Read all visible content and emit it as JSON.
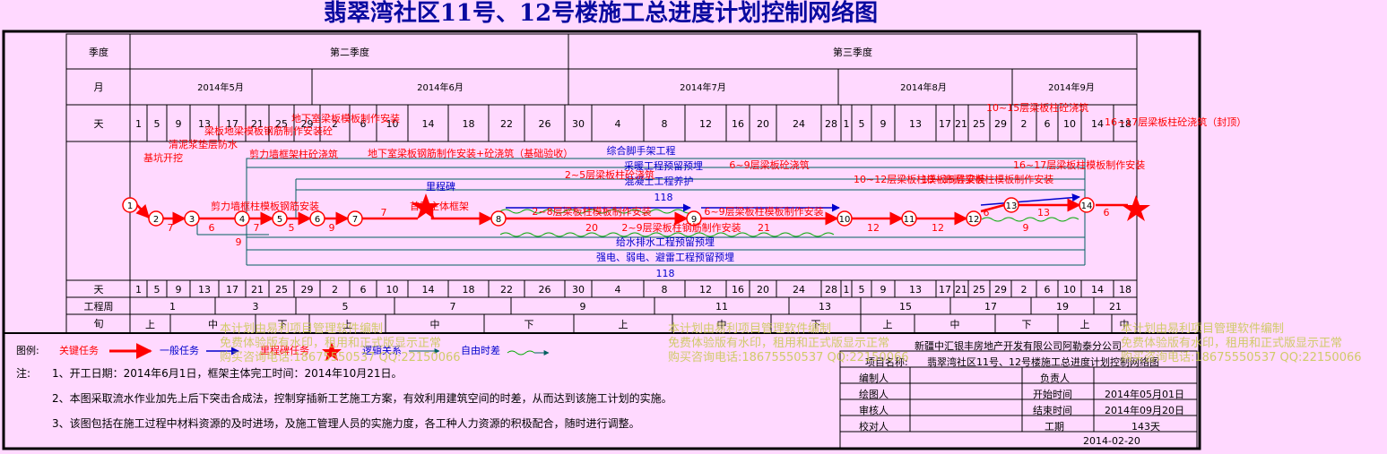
{
  "title": "翡翠湾社区11号、12号楼施工总进度计划控制网络图",
  "rows": {
    "quarter": "季度",
    "month": "月",
    "day": "天",
    "day2": "天",
    "week": "工程周",
    "xun": "旬"
  },
  "quarters": [
    {
      "label": "第二季度"
    },
    {
      "label": "第三季度"
    }
  ],
  "months": [
    {
      "label": "2014年5月"
    },
    {
      "label": "2014年6月"
    },
    {
      "label": "2014年7月"
    },
    {
      "label": "2014年8月"
    },
    {
      "label": "2014年9月"
    }
  ],
  "days": [
    "1",
    "5",
    "9",
    "13",
    "17",
    "21",
    "25",
    "29",
    "2",
    "6",
    "10",
    "14",
    "18",
    "22",
    "26",
    "30",
    "4",
    "8",
    "12",
    "16",
    "20",
    "24",
    "28",
    "1",
    "5",
    "9",
    "13",
    "17",
    "21",
    "25",
    "29",
    "2",
    "6",
    "10",
    "14",
    "18"
  ],
  "weeks": [
    "1",
    "3",
    "5",
    "7",
    "9",
    "11",
    "13",
    "15",
    "17",
    "19",
    "21"
  ],
  "xun": [
    "上",
    "中",
    "下",
    "上",
    "中",
    "下",
    "上",
    "中",
    "下",
    "上",
    "中",
    "下",
    "上",
    "中"
  ],
  "nodes": [
    "1",
    "2",
    "3",
    "4",
    "5",
    "6",
    "7",
    "8",
    "9",
    "10",
    "11",
    "12",
    "13",
    "14"
  ],
  "durations": [
    "6",
    "7",
    "6",
    "7",
    "5",
    "9",
    "7",
    "20",
    "21",
    "12",
    "12",
    "9",
    "13",
    "6",
    "9",
    "6"
  ],
  "tasks": {
    "t1": "基坑开挖",
    "t2": "清泥浆垫层防水",
    "t3": "梁板地梁模板钢筋制作安装砼",
    "t4": "剪力墙框柱模板钢筋安装",
    "t5": "剪力墙框架柱砼浇筑",
    "t6": "地下室梁板模板制作安装",
    "t7": "地下室梁板钢筋制作安装+砼浇筑（基础验收）",
    "t8": "首层主体框架",
    "t9": "2~8层梁板柱模板制作安装",
    "t10": "2~9层梁板柱钢筋制作安装",
    "t11": "6~9层梁板柱模板制作安装",
    "t12": "6~9层梁板砼浇筑",
    "t13": "2~5层梁板柱砼浇筑",
    "t14": "10~12层梁板柱模板制作安装",
    "t15": "13~15层梁板柱模板制作安装",
    "t16": "16~17层梁板柱模板制作安装",
    "t17": "16~17层梁板柱砼浇筑（封顶）",
    "t18": "10~15层梁板柱砼浇筑",
    "t19": "综合脚手架工程",
    "t20": "采暖工程预留预埋",
    "t21": "混凝土工程养护",
    "t22": "给水排水工程预留预埋",
    "t23": "强电、弱电、避雷工程预留预埋",
    "dur118a": "118",
    "dur118b": "118",
    "milestone": "里程碑"
  },
  "legend": {
    "label": "图例:",
    "critical": "关键任务",
    "normal": "一般任务",
    "milestone": "里程碑任务",
    "logic": "逻辑关系",
    "float": "自由时差"
  },
  "notes": {
    "label": "注:",
    "n1": "1、开工日期：2014年6月1日，框架主体完工时间：2014年10月21日。",
    "n2": "2、本图采取流水作业加先上后下突击合成法，控制穿插新工艺施工方案，有效利用建筑空间的时差，从而达到该施工计划的实施。",
    "n3": "3、该图包括在施工过程中材料资源的及时进场，及施工管理人员的实施力度，各工种人力资源的积极配合，随时进行调整。"
  },
  "titleblock": {
    "company": "新疆中汇银丰房地产开发有限公司阿勒泰分公司",
    "project_label": "项目名称:",
    "project": "翡翠湾社区11号、12号楼施工总进度计划控制网络图",
    "editor": "编制人",
    "owner": "负责人",
    "drawer": "绘图人",
    "start_label": "开始时间",
    "start": "2014年05月01日",
    "reviewer": "审核人",
    "end_label": "结束时间",
    "end": "2014年09月20日",
    "checker": "校对人",
    "days_label": "工期",
    "days": "143天",
    "date": "2014-02-20"
  },
  "watermark": {
    "l1": "本计划由易利项目管理软件编制",
    "l2": "免费体验版有水印，租用和正式版显示正常",
    "l3": "购买咨询电话:18675550537 QQ:22150066"
  },
  "colors": {
    "critical": "#ff0000",
    "normal": "#0000cc",
    "float": "#00aa00",
    "grid": "#006060",
    "bg": "#ffd9ff"
  }
}
